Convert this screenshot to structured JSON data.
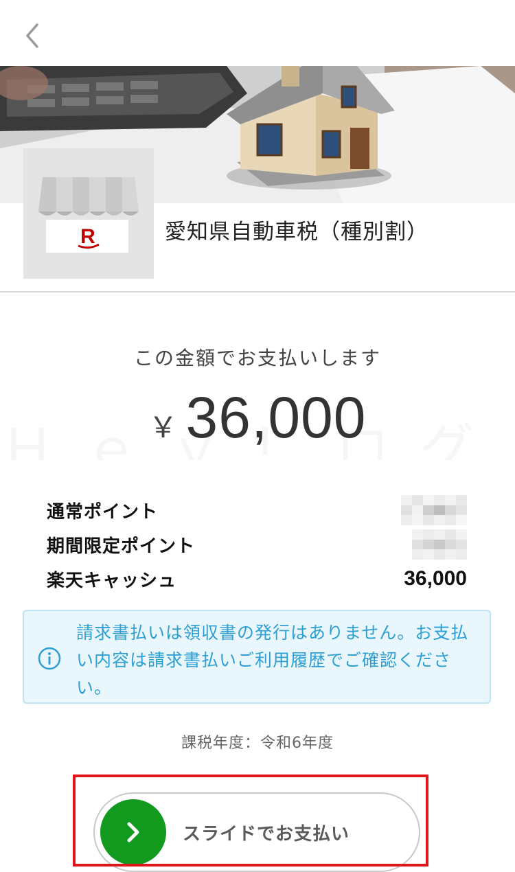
{
  "header": {
    "back_icon": "chevron-left-icon"
  },
  "banner": {
    "image": "house-model-on-desk-photo"
  },
  "biller": {
    "name": "愛知県自動車税（種別割）",
    "logo_letter": "R",
    "logo_icon": "storefront-icon",
    "brand_color": "#bf0000"
  },
  "payment": {
    "caption": "この金額でお支払いします",
    "currency_symbol": "￥",
    "amount": "36,000",
    "watermark": "Ｈｅｙ！ログ"
  },
  "points": [
    {
      "label": "通常ポイント",
      "value": null,
      "redacted": true
    },
    {
      "label": "期間限定ポイント",
      "value": null,
      "redacted": true
    },
    {
      "label": "楽天キャッシュ",
      "value": "36,000",
      "redacted": false
    }
  ],
  "notice": {
    "icon": "info-circle-icon",
    "text_lines": [
      "請求書払いは領収書の発行はありません。お支払",
      "い内容は請求書払いご利用履歴でご確認くださ",
      "い。"
    ],
    "color": "#2d9fd3"
  },
  "tax_year": "課税年度：令和6年度",
  "slider": {
    "label": "スライドでお支払い",
    "knob_icon": "chevron-right-icon",
    "knob_color": "#129a1f"
  },
  "highlight_color": "#e0151c"
}
